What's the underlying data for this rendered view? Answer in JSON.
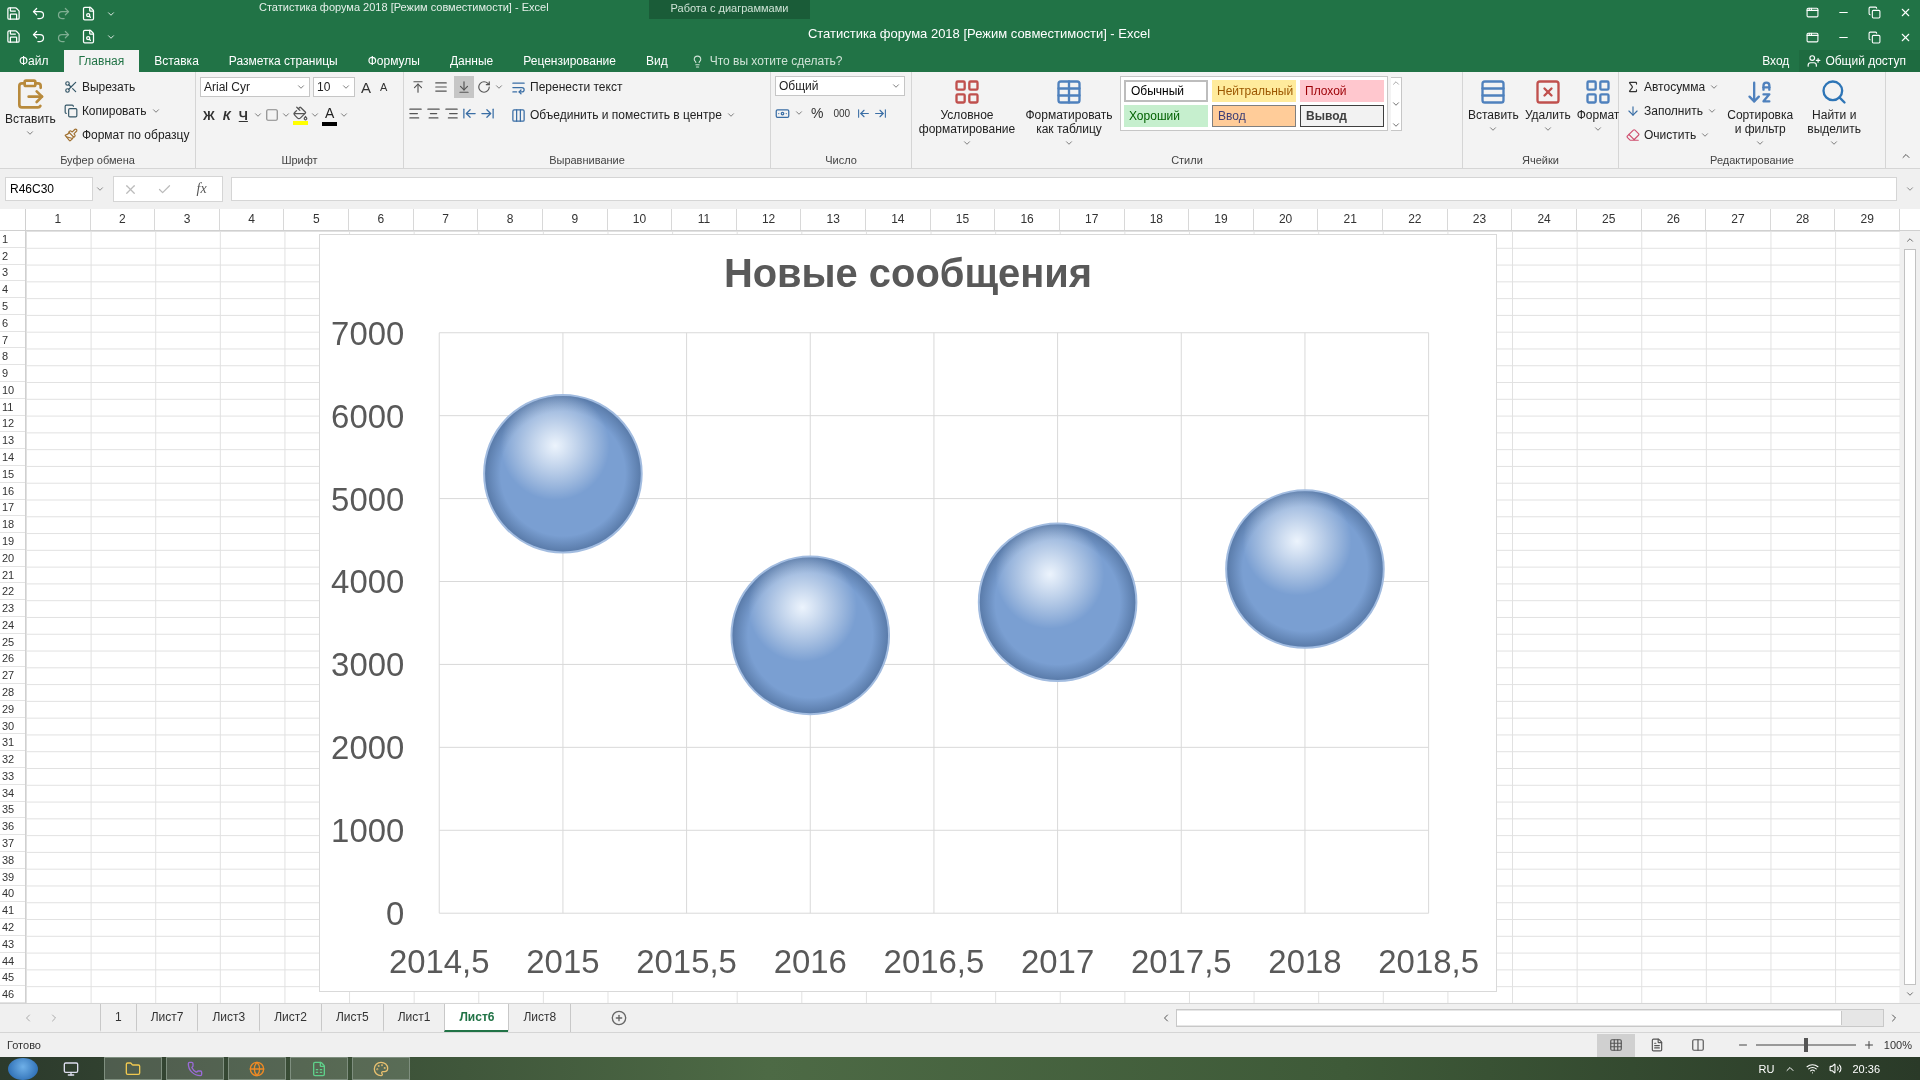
{
  "title_bar": {
    "ghost_title": "Статистика форума 2018  [Режим совместимости] - Excel",
    "context_tab": "Работа с диаграммами",
    "title": "Статистика форума 2018  [Режим совместимости] - Excel"
  },
  "menu_tabs": [
    {
      "label": "Файл",
      "selected": false
    },
    {
      "label": "Главная",
      "selected": true
    },
    {
      "label": "Вставка",
      "selected": false
    },
    {
      "label": "Разметка страницы",
      "selected": false
    },
    {
      "label": "Формулы",
      "selected": false
    },
    {
      "label": "Данные",
      "selected": false
    },
    {
      "label": "Рецензирование",
      "selected": false
    },
    {
      "label": "Вид",
      "selected": false
    }
  ],
  "tell_me": {
    "placeholder": "Что вы хотите сделать?"
  },
  "account": {
    "sign_in": "Вход",
    "share": "Общий доступ"
  },
  "ribbon": {
    "clipboard": {
      "paste": "Вставить",
      "cut": "Вырезать",
      "copy": "Копировать",
      "format_painter": "Формат по образцу",
      "label": "Буфер обмена"
    },
    "font": {
      "name": "Arial Cyr",
      "size": "10",
      "grow": "A",
      "shrink": "A",
      "bold": "Ж",
      "italic": "К",
      "underline": "Ч",
      "font_color": "A",
      "label": "Шрифт"
    },
    "alignment": {
      "vertical": [
        {
          "kind": "top",
          "selected": false
        },
        {
          "kind": "middle",
          "selected": false
        },
        {
          "kind": "bottom",
          "selected": true
        }
      ],
      "wrap": "Перенести текст",
      "merge": "Объединить и поместить в центре",
      "label": "Выравнивание"
    },
    "number": {
      "format": "Общий",
      "percent": "%",
      "thousands": "000",
      "label": "Число"
    },
    "styles": {
      "conditional": "Условное форматирование",
      "format_table": "Форматировать как таблицу",
      "cells": [
        {
          "kind": "normal",
          "label": "Обычный"
        },
        {
          "kind": "neutral",
          "label": "Нейтральный"
        },
        {
          "kind": "bad",
          "label": "Плохой"
        },
        {
          "kind": "good",
          "label": "Хороший"
        },
        {
          "kind": "input",
          "label": "Ввод"
        },
        {
          "kind": "output",
          "label": "Вывод"
        }
      ],
      "label": "Стили"
    },
    "cells": {
      "buttons": [
        "Вставить",
        "Удалить",
        "Формат"
      ],
      "label": "Ячейки"
    },
    "editing": {
      "autosum": "Автосумма",
      "fill": "Заполнить",
      "clear": "Очистить",
      "sort": "Сортировка и фильтр",
      "find": "Найти и выделить",
      "label": "Редактирование"
    }
  },
  "formula_bar": {
    "name_box": "R46C30",
    "function_label": "fx"
  },
  "column_headers": [
    "1",
    "2",
    "3",
    "4",
    "5",
    "6",
    "7",
    "8",
    "9",
    "10",
    "11",
    "12",
    "13",
    "14",
    "15",
    "16",
    "17",
    "18",
    "19",
    "20",
    "21",
    "22",
    "23",
    "24",
    "25",
    "26",
    "27",
    "28",
    "29"
  ],
  "row_headers": [
    "1",
    "2",
    "3",
    "4",
    "5",
    "6",
    "7",
    "8",
    "9",
    "10",
    "11",
    "12",
    "13",
    "14",
    "15",
    "16",
    "17",
    "18",
    "19",
    "20",
    "21",
    "22",
    "23",
    "24",
    "25",
    "26",
    "27",
    "28",
    "29",
    "30",
    "31",
    "32",
    "33",
    "34",
    "35",
    "36",
    "37",
    "38",
    "39",
    "40",
    "41",
    "42",
    "43",
    "44",
    "45",
    "46"
  ],
  "chart": {
    "chart_data": {
      "type": "scatter",
      "title": "Новые сообщения",
      "x": [
        2015,
        2016,
        2017,
        2018
      ],
      "series": [
        {
          "color": "#7a9fd2",
          "values": [
            5300,
            3350,
            3750,
            4150
          ]
        }
      ],
      "xlim": [
        2014.5,
        2018.5
      ],
      "ylim": [
        0,
        7000
      ],
      "xticks": [
        {
          "value": 2014.5,
          "label": "2014,5"
        },
        {
          "value": 2015,
          "label": "2015"
        },
        {
          "value": 2015.5,
          "label": "2015,5"
        },
        {
          "value": 2016,
          "label": "2016"
        },
        {
          "value": 2016.5,
          "label": "2016,5"
        },
        {
          "value": 2017,
          "label": "2017"
        },
        {
          "value": 2017.5,
          "label": "2017,5"
        },
        {
          "value": 2018,
          "label": "2018"
        },
        {
          "value": 2018.5,
          "label": "2018,5"
        }
      ],
      "yticks": [
        0,
        1000,
        2000,
        3000,
        4000,
        5000,
        6000,
        7000
      ],
      "grid": true
    }
  },
  "sheet_tabs": [
    {
      "label": "1",
      "selected": false
    },
    {
      "label": "Лист7",
      "selected": false
    },
    {
      "label": "Лист3",
      "selected": false
    },
    {
      "label": "Лист2",
      "selected": false
    },
    {
      "label": "Лист5",
      "selected": false
    },
    {
      "label": "Лист1",
      "selected": false
    },
    {
      "label": "Лист6",
      "selected": true
    },
    {
      "label": "Лист8",
      "selected": false
    }
  ],
  "status_bar": {
    "status": "Готово",
    "views": [
      {
        "kind": "normal",
        "selected": true
      },
      {
        "kind": "page_layout",
        "selected": false
      },
      {
        "kind": "page_break",
        "selected": false
      }
    ],
    "zoom": {
      "level": 0.5
    },
    "zoom_label": "100%"
  },
  "taskbar": {
    "language": "RU",
    "time": "20:36"
  }
}
